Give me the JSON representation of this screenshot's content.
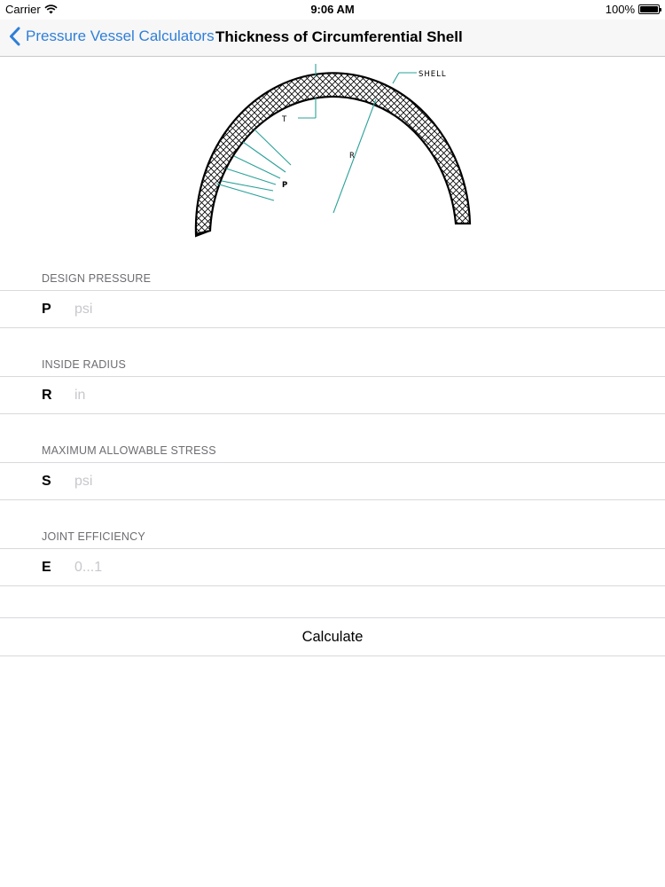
{
  "status_bar": {
    "carrier": "Carrier",
    "time": "9:06 AM",
    "battery": "100%"
  },
  "nav": {
    "back_label": "Pressure Vessel Calculators",
    "title": "Thickness of Circumferential Shell"
  },
  "diagram": {
    "labels": {
      "shell": "SHELL",
      "t": "T",
      "r": "R",
      "p": "P"
    },
    "accent_color": "#2aa198"
  },
  "fields": [
    {
      "header": "DESIGN PRESSURE",
      "symbol": "P",
      "value": "",
      "placeholder": "psi"
    },
    {
      "header": "INSIDE RADIUS",
      "symbol": "R",
      "value": "",
      "placeholder": "in"
    },
    {
      "header": "MAXIMUM ALLOWABLE STRESS",
      "symbol": "S",
      "value": "",
      "placeholder": "psi"
    },
    {
      "header": "JOINT EFFICIENCY",
      "symbol": "E",
      "value": "",
      "placeholder": "0...1"
    }
  ],
  "calculate_label": "Calculate",
  "colors": {
    "tint": "#2f7fd8",
    "nav_bg": "#f7f7f7",
    "separator": "#d9d9de",
    "header_text": "#6d6d72",
    "placeholder": "#c7c7cd"
  }
}
